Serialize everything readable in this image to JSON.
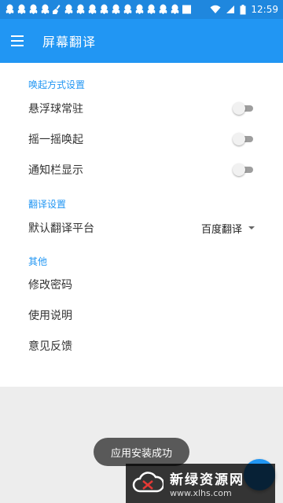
{
  "status_bar": {
    "time": "12:59",
    "notification_icons": [
      "qq-icon",
      "qq-icon",
      "qq-icon",
      "qq-icon",
      "broom-icon",
      "qq-icon",
      "qq-icon",
      "qq-icon",
      "qq-icon",
      "qq-icon",
      "qq-icon",
      "qq-icon",
      "qq-icon",
      "qq-icon",
      "qq-icon",
      "square-icon"
    ],
    "accent": "#1f87de"
  },
  "app_bar": {
    "title": "屏幕翻译",
    "color": "#2196f3"
  },
  "sections": {
    "wake": {
      "header": "唤起方式设置",
      "items": [
        {
          "label": "悬浮球常驻",
          "switch_on": false
        },
        {
          "label": "摇一摇唤起",
          "switch_on": false
        },
        {
          "label": "通知栏显示",
          "switch_on": false
        }
      ]
    },
    "translate": {
      "header": "翻译设置",
      "default_platform_label": "默认翻译平台",
      "default_platform_value": "百度翻译"
    },
    "other": {
      "header": "其他",
      "items": [
        "修改密码",
        "使用说明",
        "意见反馈"
      ]
    }
  },
  "toast": {
    "text": "应用安装成功"
  },
  "watermark": {
    "title": "新绿资源网",
    "url": "www.xlhs.com"
  }
}
